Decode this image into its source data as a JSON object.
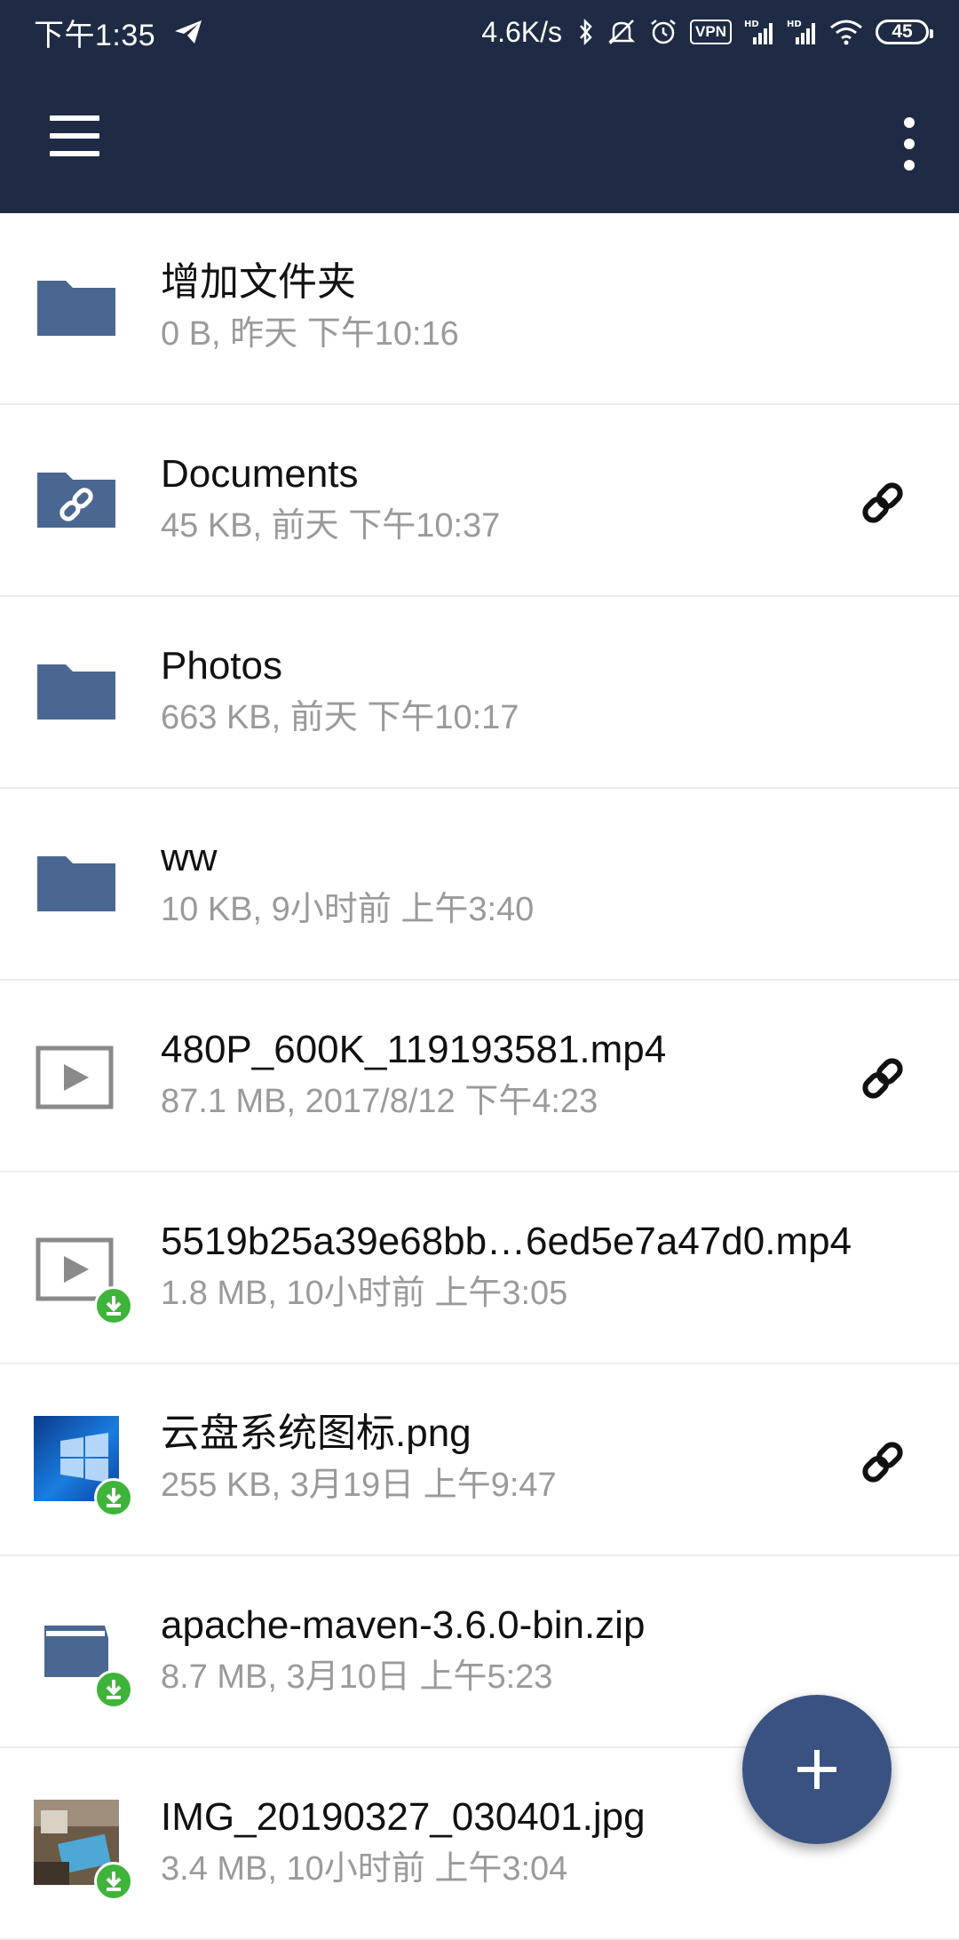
{
  "status_bar": {
    "time": "下午1:35",
    "net_speed": "4.6K/s",
    "vpn": "VPN",
    "battery": "45",
    "icons": [
      "telegram-icon",
      "bluetooth-icon",
      "mute-icon",
      "alarm-icon",
      "vpn-icon",
      "signal-hd-icon",
      "signal-hd-icon",
      "wifi-icon",
      "battery-icon"
    ]
  },
  "toolbar": {
    "menu_icon": "hamburger-menu-icon",
    "more_icon": "more-vertical-icon"
  },
  "files": [
    {
      "name": "增加文件夹",
      "meta": "0 B, 昨天 下午10:16",
      "type": "folder",
      "shared": false,
      "downloaded": false
    },
    {
      "name": "Documents",
      "meta": "45 KB, 前天 下午10:37",
      "type": "folder-shared",
      "shared": true,
      "downloaded": false
    },
    {
      "name": "Photos",
      "meta": "663 KB, 前天 下午10:17",
      "type": "folder",
      "shared": false,
      "downloaded": false
    },
    {
      "name": "ww",
      "meta": "10 KB, 9小时前 上午3:40",
      "type": "folder",
      "shared": false,
      "downloaded": false
    },
    {
      "name": "480P_600K_119193581.mp4",
      "meta": "87.1 MB, 2017/8/12 下午4:23",
      "type": "video",
      "shared": true,
      "downloaded": false
    },
    {
      "name": "5519b25a39e68bb…6ed5e7a47d0.mp4",
      "meta": "1.8 MB, 10小时前 上午3:05",
      "type": "video",
      "shared": false,
      "downloaded": true
    },
    {
      "name": "云盘系统图标.png",
      "meta": "255 KB, 3月19日 上午9:47",
      "type": "image-windows",
      "shared": true,
      "downloaded": true
    },
    {
      "name": "apache-maven-3.6.0-bin.zip",
      "meta": "8.7 MB, 3月10日 上午5:23",
      "type": "archive",
      "shared": false,
      "downloaded": true
    },
    {
      "name": "IMG_20190327_030401.jpg",
      "meta": "3.4 MB, 10小时前 上午3:04",
      "type": "image-photo",
      "shared": false,
      "downloaded": true
    }
  ],
  "fab": {
    "icon": "plus-icon"
  },
  "colors": {
    "toolbar": "#1f2b44",
    "folder": "#4a6792",
    "fab": "#3a5282",
    "download_badge": "#3fb43a",
    "meta_text": "#9a9a9a"
  }
}
